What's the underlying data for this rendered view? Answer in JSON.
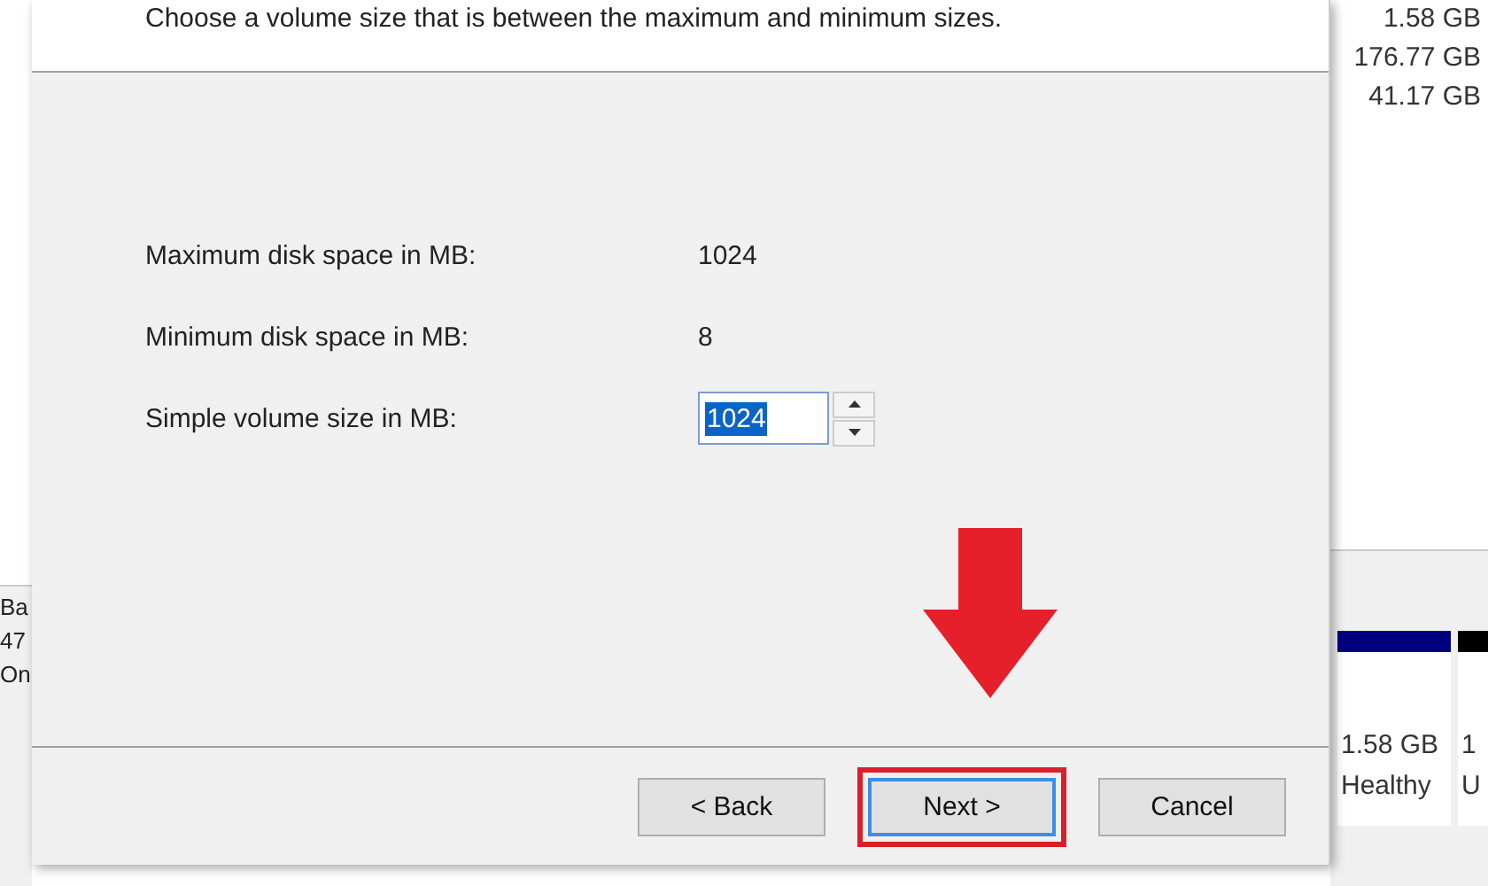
{
  "dialog": {
    "instruction": "Choose a volume size that is between the maximum and minimum sizes.",
    "fields": [
      {
        "kind": "reading",
        "label": "Maximum disk space in MB:",
        "value": "1024"
      },
      {
        "kind": "reading",
        "label": "Minimum disk space in MB:",
        "value": "8"
      },
      {
        "kind": "spinner",
        "label": "Simple volume size in MB:",
        "value": "1024",
        "highlighted": true
      }
    ],
    "buttons": [
      {
        "label": "< Back",
        "focused": false,
        "marked": false
      },
      {
        "label": "Next >",
        "focused": true,
        "marked": true
      },
      {
        "label": "Cancel",
        "focused": false,
        "marked": false
      }
    ]
  },
  "background": {
    "left_column": [
      "Ba",
      "47",
      "On"
    ],
    "right_sizes": [
      "1.58 GB",
      "176.77 GB",
      "41.17 GB"
    ],
    "partitions": [
      {
        "color": "#000080",
        "lines": [
          "1.58 GB",
          "Healthy"
        ]
      },
      {
        "color": "#000000",
        "lines": [
          "1",
          "U"
        ]
      }
    ]
  }
}
